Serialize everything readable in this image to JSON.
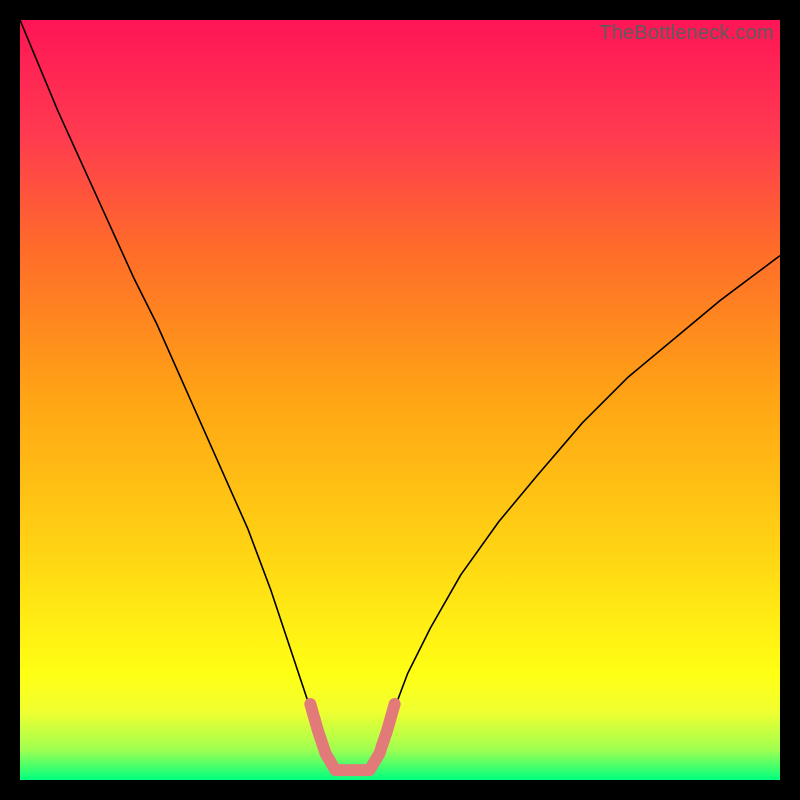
{
  "watermark": "TheBottleneck.com",
  "chart_data": {
    "type": "line",
    "title": "",
    "xlabel": "",
    "ylabel": "",
    "xlim": [
      0,
      100
    ],
    "ylim": [
      0,
      100
    ],
    "background_gradient_stops": [
      {
        "pos": 0.0,
        "color": "#00ff80"
      },
      {
        "pos": 0.04,
        "color": "#a0ff50"
      },
      {
        "pos": 0.09,
        "color": "#f0ff30"
      },
      {
        "pos": 0.14,
        "color": "#ffff14"
      },
      {
        "pos": 0.3,
        "color": "#ffd414"
      },
      {
        "pos": 0.5,
        "color": "#ffa514"
      },
      {
        "pos": 0.7,
        "color": "#ff6b2a"
      },
      {
        "pos": 0.85,
        "color": "#ff3a50"
      },
      {
        "pos": 1.0,
        "color": "#ff1556"
      }
    ],
    "series": [
      {
        "name": "bottleneck-curve",
        "stroke": "#000000",
        "stroke_width": 1.6,
        "x": [
          0,
          5,
          10,
          15,
          18,
          22,
          26,
          30,
          33,
          36,
          37,
          38,
          39,
          40,
          41.5,
          46,
          47.5,
          48.5,
          49.5,
          51,
          54,
          58,
          63,
          68,
          74,
          80,
          86,
          92,
          96,
          100
        ],
        "y": [
          100,
          88,
          77,
          66,
          60,
          51,
          42,
          33,
          25,
          16,
          13,
          10,
          6.5,
          3.5,
          1.4,
          1.4,
          3.5,
          6.5,
          10,
          14,
          20,
          27,
          34,
          40,
          47,
          53,
          58,
          63,
          66,
          69
        ]
      },
      {
        "name": "optimal-zone-highlight",
        "stroke": "#e27a7a",
        "stroke_width": 12,
        "linecap": "round",
        "x": [
          38.2,
          39.2,
          40.2,
          41.5,
          46.0,
          47.3,
          48.3,
          49.3
        ],
        "y": [
          10.0,
          6.5,
          3.5,
          1.3,
          1.3,
          3.5,
          6.5,
          10.0
        ]
      }
    ]
  }
}
